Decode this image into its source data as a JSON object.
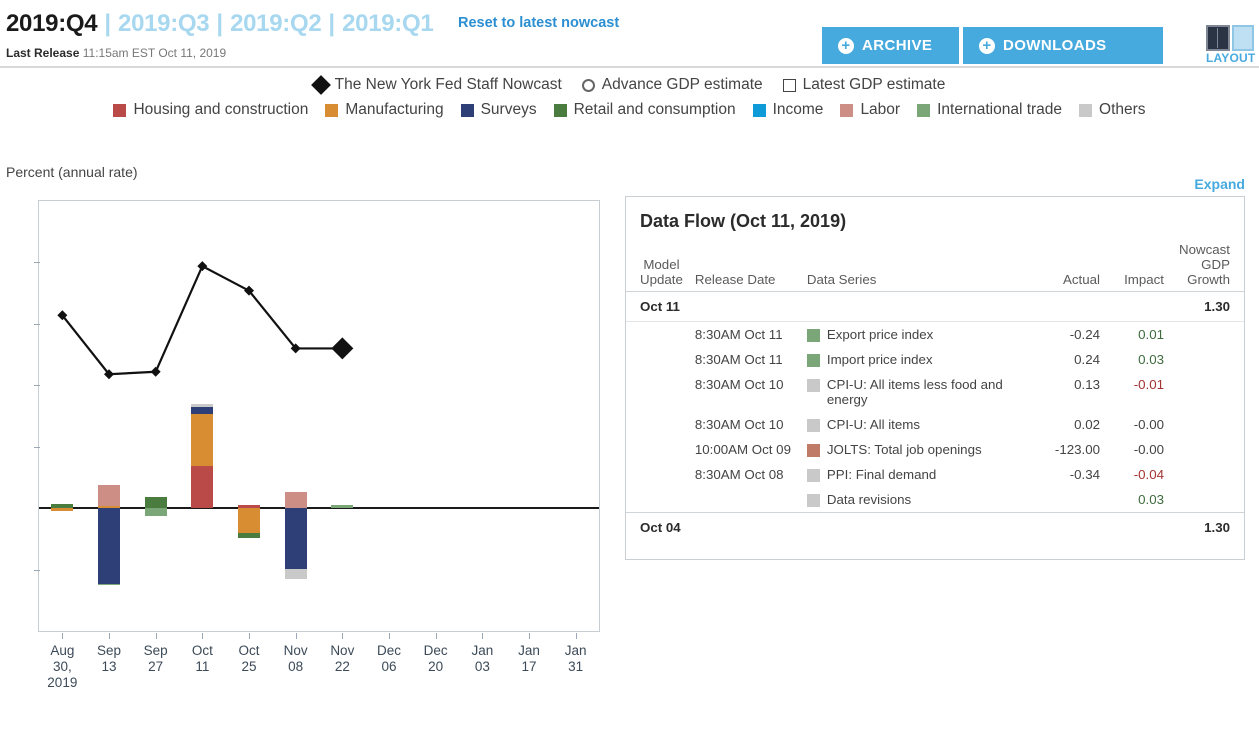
{
  "header": {
    "quarters": [
      {
        "label": "2019:Q4",
        "active": true
      },
      {
        "label": "2019:Q3",
        "active": false
      },
      {
        "label": "2019:Q2",
        "active": false
      },
      {
        "label": "2019:Q1",
        "active": false
      }
    ],
    "separator": "|",
    "reset_label": "Reset to latest nowcast",
    "last_release_label": "Last Release",
    "last_release_value": "11:15am EST Oct 11, 2019",
    "archive_label": "ARCHIVE",
    "downloads_label": "DOWNLOADS",
    "layout_label": "LAYOUT",
    "accent_color": "#46aadf"
  },
  "legend": {
    "markers": [
      {
        "name": "The New York Fed Staff Nowcast",
        "marker": "diamond"
      },
      {
        "name": "Advance GDP estimate",
        "marker": "circle"
      },
      {
        "name": "Latest GDP estimate",
        "marker": "square"
      }
    ],
    "categories": [
      {
        "name": "Housing and construction",
        "color": "#b94a48"
      },
      {
        "name": "Manufacturing",
        "color": "#d98d33"
      },
      {
        "name": "Surveys",
        "color": "#2e3f77"
      },
      {
        "name": "Retail and consumption",
        "color": "#4a7c3f"
      },
      {
        "name": "Income",
        "color": "#0f9bd7"
      },
      {
        "name": "Labor",
        "color": "#cd8e86"
      },
      {
        "name": "International trade",
        "color": "#7ba678"
      },
      {
        "name": "Others",
        "color": "#c9c9c9"
      }
    ]
  },
  "chart_header": {
    "axis_title": "Percent (annual rate)",
    "expand_label": "Expand"
  },
  "chart_data": {
    "type": "bar",
    "title": "",
    "xlabel": "",
    "ylabel": "Percent (annual rate)",
    "ylim": [
      -1.0,
      2.5
    ],
    "yticks": [
      "2.5",
      "2.0",
      "1.5",
      "1.0",
      "0.5",
      "0",
      "-0.5",
      "-1.0"
    ],
    "ytick_values": [
      2.5,
      2.0,
      1.5,
      1.0,
      0.5,
      0,
      -0.5,
      -1.0
    ],
    "grid": false,
    "legend_position": "top",
    "categories": [
      "Aug 30, 2019",
      "Sep 13",
      "Sep 27",
      "Oct 11",
      "Oct 25",
      "Nov 08",
      "Nov 22",
      "Dec 06",
      "Dec 20",
      "Jan 03",
      "Jan 17",
      "Jan 31"
    ],
    "category_lines": [
      [
        "Aug",
        "30,",
        "2019"
      ],
      [
        "Sep",
        "13"
      ],
      [
        "Sep",
        "27"
      ],
      [
        "Oct",
        "11"
      ],
      [
        "Oct",
        "25"
      ],
      [
        "Nov",
        "08"
      ],
      [
        "Nov",
        "22"
      ],
      [
        "Dec",
        "06"
      ],
      [
        "Dec",
        "20"
      ],
      [
        "Jan",
        "03"
      ],
      [
        "Jan",
        "17"
      ],
      [
        "Jan",
        "31"
      ]
    ],
    "series": [
      {
        "name": "Housing and construction",
        "color": "#b94a48",
        "values": [
          0,
          0,
          0,
          0.345,
          0.025,
          0,
          0,
          0,
          0,
          0,
          0,
          0
        ]
      },
      {
        "name": "Manufacturing",
        "color": "#d98d33",
        "values": [
          -0.02,
          0.02,
          0,
          0.42,
          -0.205,
          0,
          0,
          0,
          0,
          0,
          0,
          0
        ]
      },
      {
        "name": "Surveys",
        "color": "#2e3f77",
        "values": [
          0,
          -0.615,
          0,
          0.06,
          0,
          -0.495,
          0,
          0,
          0,
          0,
          0,
          0
        ]
      },
      {
        "name": "Retail and consumption",
        "color": "#4a7c3f",
        "values": [
          0.035,
          0,
          0.09,
          0,
          -0.035,
          0,
          0,
          0,
          0,
          0,
          0,
          0
        ]
      },
      {
        "name": "Income",
        "color": "#0f9bd7",
        "values": [
          0,
          0,
          0,
          0,
          0,
          0,
          0,
          0,
          0,
          0,
          0,
          0
        ]
      },
      {
        "name": "Labor",
        "color": "#cd8e86",
        "values": [
          0,
          0.17,
          0,
          0,
          0,
          0.13,
          0,
          0,
          0,
          0,
          0,
          0
        ]
      },
      {
        "name": "International trade",
        "color": "#7ba678",
        "values": [
          0,
          -0.01,
          -0.06,
          0,
          0,
          0,
          0.025,
          0,
          0,
          0,
          0,
          0
        ]
      },
      {
        "name": "Others",
        "color": "#c9c9c9",
        "values": [
          0,
          0,
          0,
          0.02,
          0,
          -0.08,
          0,
          0,
          0,
          0,
          0,
          0
        ]
      }
    ],
    "nowcast_line": {
      "name": "The New York Fed Staff Nowcast",
      "color": "#111111",
      "x": [
        0,
        1,
        2,
        3,
        4,
        5
      ],
      "values": [
        1.57,
        1.09,
        1.11,
        1.97,
        1.77,
        1.3
      ],
      "current_point": {
        "x": 6,
        "value": 1.3,
        "highlight": true
      }
    }
  },
  "data_flow": {
    "title": "Data Flow (Oct 11, 2019)",
    "columns": {
      "model_update": "Model Update",
      "model_update_line1": "Model",
      "model_update_line2": "Update",
      "release_date": "Release Date",
      "data_series": "Data Series",
      "actual": "Actual",
      "impact": "Impact",
      "nowcast_growth": "Nowcast GDP Growth",
      "nowcast_line1": "Nowcast",
      "nowcast_line2": "GDP",
      "nowcast_line3": "Growth"
    },
    "groups": [
      {
        "model_update": "Oct 11",
        "nowcast_gdp_growth": "1.30",
        "rows": [
          {
            "release_date": "8:30AM Oct 11",
            "series": "Export price index",
            "color": "#7ba678",
            "actual": "-0.24",
            "impact": "0.01",
            "impact_sign": "pos"
          },
          {
            "release_date": "8:30AM Oct 11",
            "series": "Import price index",
            "color": "#7ba678",
            "actual": "0.24",
            "impact": "0.03",
            "impact_sign": "pos"
          },
          {
            "release_date": "8:30AM Oct 10",
            "series": "CPI-U: All items less food and energy",
            "color": "#c9c9c9",
            "actual": "0.13",
            "impact": "-0.01",
            "impact_sign": "neg"
          },
          {
            "release_date": "8:30AM Oct 10",
            "series": "CPI-U: All items",
            "color": "#c9c9c9",
            "actual": "0.02",
            "impact": "-0.00",
            "impact_sign": "num"
          },
          {
            "release_date": "10:00AM Oct 09",
            "series": "JOLTS: Total job openings",
            "color": "#c07a68",
            "actual": "-123.00",
            "impact": "-0.00",
            "impact_sign": "num"
          },
          {
            "release_date": "8:30AM Oct 08",
            "series": "PPI: Final demand",
            "color": "#c9c9c9",
            "actual": "-0.34",
            "impact": "-0.04",
            "impact_sign": "neg"
          },
          {
            "release_date": "",
            "series": "Data revisions",
            "color": "#c9c9c9",
            "actual": "",
            "impact": "0.03",
            "impact_sign": "pos"
          }
        ]
      },
      {
        "model_update": "Oct 04",
        "nowcast_gdp_growth": "1.30",
        "rows": []
      }
    ]
  }
}
